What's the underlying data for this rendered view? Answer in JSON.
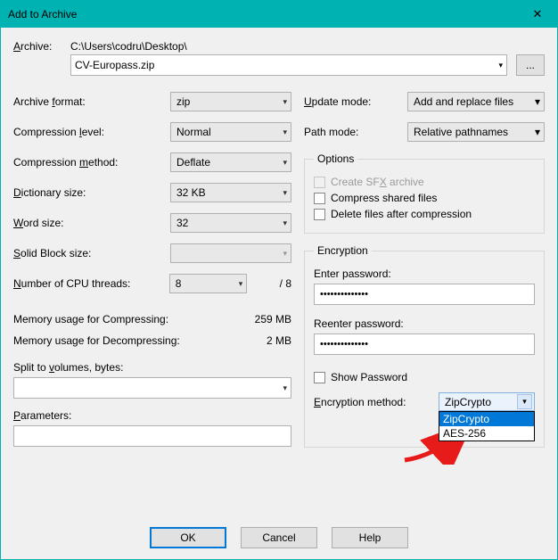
{
  "title": "Add to Archive",
  "archive": {
    "label": "Archive:",
    "label_u": "A",
    "path": "C:\\Users\\codru\\Desktop\\",
    "filename": "CV-Europass.zip",
    "browse": "..."
  },
  "left": {
    "format": {
      "label": "Archive format:",
      "u": "f",
      "value": "zip"
    },
    "level": {
      "label": "Compression level:",
      "u": "l",
      "value": "Normal"
    },
    "method": {
      "label": "Compression method:",
      "u": "m",
      "value": "Deflate"
    },
    "dict": {
      "label": "Dictionary size:",
      "u": "D",
      "value": "32 KB"
    },
    "word": {
      "label": "Word size:",
      "u": "W",
      "value": "32"
    },
    "solid": {
      "label": "Solid Block size:",
      "u": "S",
      "value": ""
    },
    "cpu": {
      "label": "Number of CPU threads:",
      "u": "N",
      "value": "8",
      "total": "/ 8"
    },
    "mem_comp": {
      "label": "Memory usage for Compressing:",
      "value": "259 MB"
    },
    "mem_decomp": {
      "label": "Memory usage for Decompressing:",
      "value": "2 MB"
    },
    "split": {
      "label": "Split to volumes, bytes:",
      "u": "v",
      "value": ""
    },
    "params": {
      "label": "Parameters:",
      "u": "P",
      "value": ""
    }
  },
  "right": {
    "update": {
      "label": "Update mode:",
      "u": "U",
      "value": "Add and replace files"
    },
    "pathmode": {
      "label": "Path mode:",
      "value": "Relative pathnames"
    },
    "options": {
      "legend": "Options",
      "sfx": {
        "label": "Create SFX archive",
        "u": "X"
      },
      "shared": {
        "label": "Compress shared files"
      },
      "delete": {
        "label": "Delete files after compression"
      }
    },
    "encryption": {
      "legend": "Encryption",
      "enter": "Enter password:",
      "reenter": "Reenter password:",
      "mask": "••••••••••••••",
      "show": "Show Password",
      "method_label": "Encryption method:",
      "method_u": "E",
      "selected": "ZipCrypto",
      "options": [
        "ZipCrypto",
        "AES-256"
      ]
    }
  },
  "buttons": {
    "ok": "OK",
    "cancel": "Cancel",
    "help": "Help"
  }
}
